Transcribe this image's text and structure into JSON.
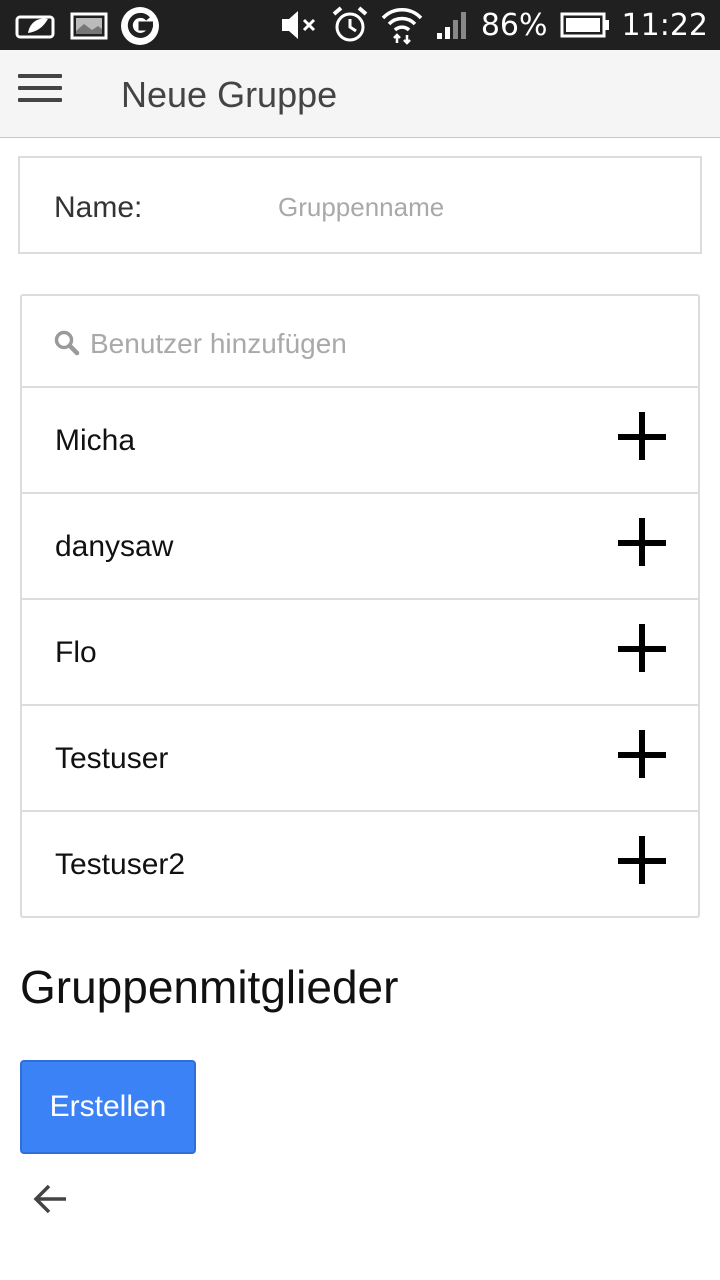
{
  "status_bar": {
    "battery_percent": "86%",
    "time": "11:22",
    "icons": [
      "leaf-notification-icon",
      "image-notification-icon",
      "g-app-icon",
      "mute-icon",
      "alarm-icon",
      "wifi-icon",
      "signal-icon",
      "battery-icon"
    ]
  },
  "app_bar": {
    "title": "Neue Gruppe"
  },
  "name_field": {
    "label": "Name:",
    "placeholder": "Gruppenname",
    "value": ""
  },
  "search": {
    "placeholder": "Benutzer hinzufügen",
    "value": ""
  },
  "users": [
    {
      "name": "Micha"
    },
    {
      "name": "danysaw"
    },
    {
      "name": "Flo"
    },
    {
      "name": "Testuser"
    },
    {
      "name": "Testuser2"
    }
  ],
  "members": {
    "heading": "Gruppenmitglieder"
  },
  "actions": {
    "create_label": "Erstellen"
  },
  "colors": {
    "primary_button": "#3b82f6",
    "status_bar": "#202020",
    "app_bar": "#f5f5f5"
  }
}
